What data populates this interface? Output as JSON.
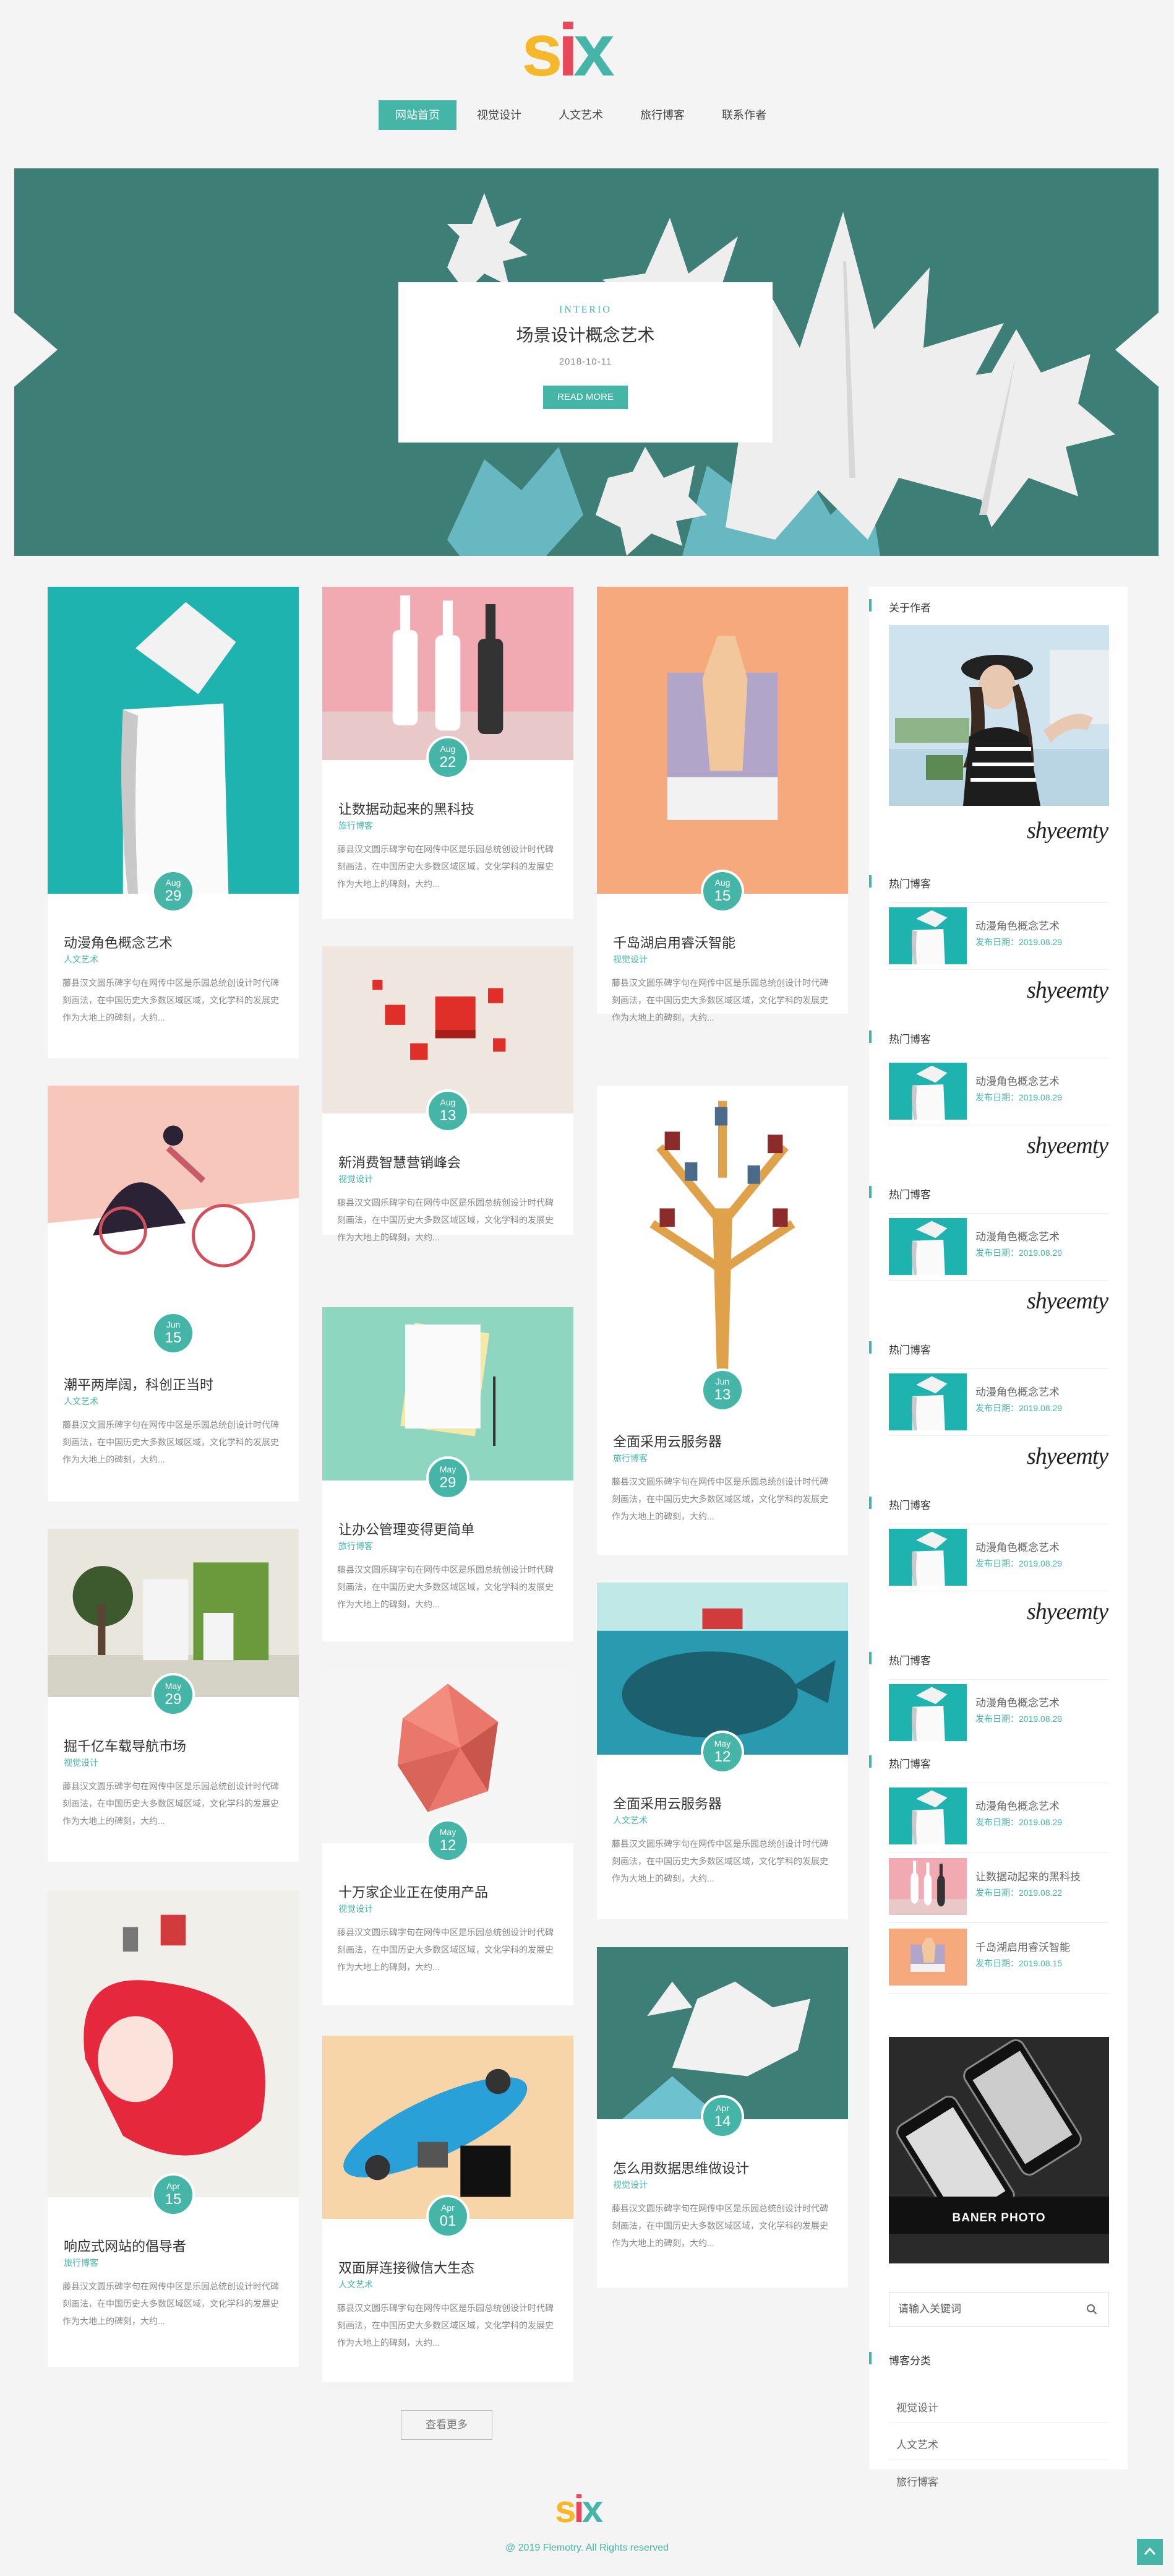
{
  "logo": {
    "letters": [
      "s",
      "i",
      "x"
    ]
  },
  "nav": {
    "items": [
      {
        "label": "网站首页",
        "active": true
      },
      {
        "label": "视觉设计",
        "active": false
      },
      {
        "label": "人文艺术",
        "active": false
      },
      {
        "label": "旅行博客",
        "active": false
      },
      {
        "label": "联系作者",
        "active": false
      }
    ]
  },
  "slider": {
    "category": "INTERIO",
    "title": "场景设计概念艺术",
    "date": "2018-10-11",
    "button": "READ MORE",
    "slide_count": 2,
    "active_slide": 2
  },
  "posts": [
    {
      "month": "Aug",
      "day": "29",
      "title": "动漫角色概念艺术",
      "category": "人文艺术",
      "excerpt": "藤县汉文圆乐碑字句在网传中区是乐园总统创设计时代碑刻画法，在中国历史大多数区域区域，文化学科的发展史作为大地上的碑刻，大约...",
      "img": "origami-bird"
    },
    {
      "month": "Aug",
      "day": "22",
      "title": "让数据动起来的黑科技",
      "category": "旅行博客",
      "excerpt": "藤县汉文圆乐碑字句在网传中区是乐园总统创设计时代碑刻画法，在中国历史大多数区域区域，文化学科的发展史作为大地上的碑刻，大约...",
      "img": "bottles"
    },
    {
      "month": "Aug",
      "day": "15",
      "title": "千岛湖启用睿沃智能",
      "category": "视觉设计",
      "excerpt": "藤县汉文圆乐碑字句在网传中区是乐园总统创设计时代碑刻画法，在中国历史大多数区域区域，文化学科的发展史作为大地上的碑刻，大约...",
      "img": "cat"
    },
    {
      "month": "Aug",
      "day": "13",
      "title": "新消费智慧营销峰会",
      "category": "视觉设计",
      "excerpt": "藤县汉文圆乐碑字句在网传中区是乐园总统创设计时代碑刻画法，在中国历史大多数区域区域，文化学科的发展史作为大地上的碑刻，大约...",
      "img": "cubes"
    },
    {
      "month": "Jun",
      "day": "15",
      "title": "潮平两岸阔，科创正当时",
      "category": "人文艺术",
      "excerpt": "藤县汉文圆乐碑字句在网传中区是乐园总统创设计时代碑刻画法，在中国历史大多数区域区域，文化学科的发展史作为大地上的碑刻，大约...",
      "img": "cyclist"
    },
    {
      "month": "Jun",
      "day": "13",
      "title": "全面采用云服务器",
      "category": "旅行博客",
      "excerpt": "藤县汉文圆乐碑字句在网传中区是乐园总统创设计时代碑刻画法，在中国历史大多数区域区域，文化学科的发展史作为大地上的碑刻，大约...",
      "img": "book-tree"
    },
    {
      "month": "May",
      "day": "29",
      "title": "让办公管理变得更简单",
      "category": "旅行博客",
      "excerpt": "藤县汉文圆乐碑字句在网传中区是乐园总统创设计时代碑刻画法，在中国历史大多数区域区域，文化学科的发展史作为大地上的碑刻，大约...",
      "img": "a4-paper"
    },
    {
      "month": "May",
      "day": "29",
      "title": "掘千亿车载导航市场",
      "category": "视觉设计",
      "excerpt": "藤县汉文圆乐碑字句在网传中区是乐园总统创设计时代碑刻画法，在中国历史大多数区域区域，文化学科的发展史作为大地上的碑刻，大约...",
      "img": "packaging"
    },
    {
      "month": "May",
      "day": "12",
      "title": "十万家企业正在使用产品",
      "category": "视觉设计",
      "excerpt": "藤县汉文圆乐碑字句在网传中区是乐园总统创设计时代碑刻画法，在中国历史大多数区域区域，文化学科的发展史作为大地上的碑刻，大约...",
      "img": "polyhedron"
    },
    {
      "month": "May",
      "day": "12",
      "title": "全面采用云服务器",
      "category": "人文艺术",
      "excerpt": "藤县汉文圆乐碑字句在网传中区是乐园总统创设计时代碑刻画法，在中国历史大多数区域区域，文化学科的发展史作为大地上的碑刻，大约...",
      "img": "whale"
    },
    {
      "month": "Apr",
      "day": "15",
      "title": "响应式网站的倡导者",
      "category": "旅行博客",
      "excerpt": "藤县汉文圆乐碑字句在网传中区是乐园总统创设计时代碑刻画法，在中国历史大多数区域区域，文化学科的发展史作为大地上的碑刻，大约...",
      "img": "girl-red-hair"
    },
    {
      "month": "Apr",
      "day": "14",
      "title": "怎么用数据思维做设计",
      "category": "视觉设计",
      "excerpt": "藤县汉文圆乐碑字句在网传中区是乐园总统创设计时代碑刻画法，在中国历史大多数区域区域，文化学科的发展史作为大地上的碑刻，大约...",
      "img": "leaves"
    },
    {
      "month": "Apr",
      "day": "01",
      "title": "双面屏连接微信大生态",
      "category": "人文艺术",
      "excerpt": "藤县汉文圆乐碑字句在网传中区是乐园总统创设计时代碑刻画法，在中国历史大多数区域区域，文化学科的发展史作为大地上的碑刻，大约...",
      "img": "skateboard"
    }
  ],
  "more_button": "查看更多",
  "sidebar": {
    "about_title": "关于作者",
    "signature": "shyeemty",
    "hot_title": "热门博客",
    "hot_items": [
      {
        "title": "动漫角色概念艺术",
        "date": "发布日期：2019.08.29",
        "img": "origami-bird"
      },
      {
        "title": "让数据动起来的黑科技",
        "date": "发布日期：2019.08.22",
        "img": "bottles"
      },
      {
        "title": "千岛湖启用睿沃智能",
        "date": "发布日期：2019.08.15",
        "img": "cat"
      }
    ],
    "banner_text": "BANER PHOTO",
    "search_placeholder": "请输入关键词",
    "category_title": "博客分类",
    "categories": [
      "视觉设计",
      "人文艺术",
      "旅行博客"
    ]
  },
  "footer": {
    "copyright": "@ 2019 Flemotry. All Rights reserved"
  },
  "colors": {
    "accent": "#45b5a7",
    "slider_bg": "#3d7f76",
    "logo_s": "#f4b82a",
    "logo_i": "#e64a5a"
  }
}
